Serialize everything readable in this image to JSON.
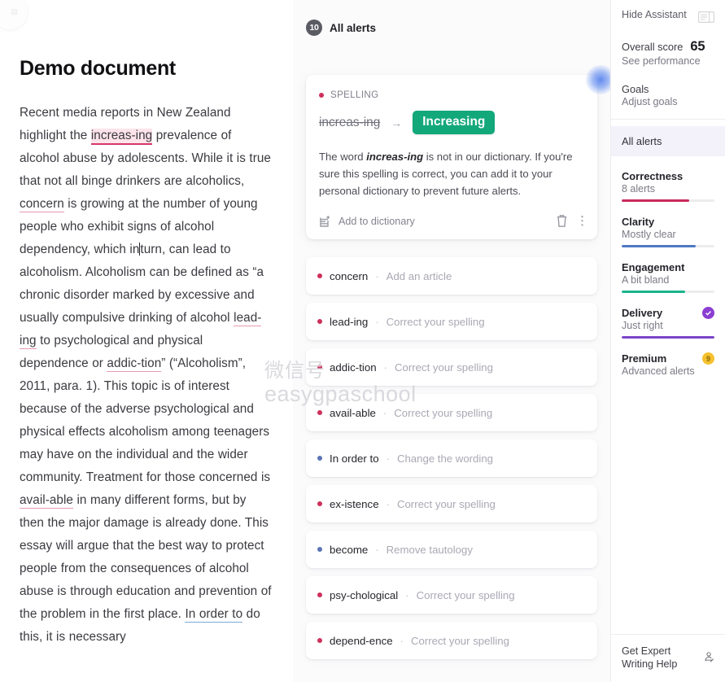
{
  "document": {
    "title": "Demo document",
    "paragraph_parts": [
      {
        "t": "Recent media reports in New Zealand highlight the ",
        "k": "plain"
      },
      {
        "t": "increas-ing",
        "k": "spelling-highlight"
      },
      {
        "t": " prevalence of alcohol abuse by adolescents. While it is true that not all binge drinkers are alcoholics, ",
        "k": "plain"
      },
      {
        "t": "concern",
        "k": "spelling-underline"
      },
      {
        "t": " is growing at the number of young people who exhibit signs of alcohol dependency, which in",
        "k": "plain"
      },
      {
        "t": "|",
        "k": "caret"
      },
      {
        "t": "turn, can lead to alcoholism. Alcoholism can be defined as “a chronic disorder marked by excessive and usually compulsive drinking of alcohol ",
        "k": "plain"
      },
      {
        "t": "lead-ing",
        "k": "spelling-underline"
      },
      {
        "t": " to psychological and physical dependence or ",
        "k": "plain"
      },
      {
        "t": "addic-tion",
        "k": "spelling-underline"
      },
      {
        "t": "” (“Alcoholism”, 2011, para. 1). This topic is of interest because of the adverse psychological and physical effects alcoholism among teenagers may have on the individual and the wider community. Treatment for those concerned is ",
        "k": "plain"
      },
      {
        "t": "avail-able",
        "k": "spelling-underline"
      },
      {
        "t": " in many different forms, but by then the major damage is already done. This essay will argue that the best way to protect people from the consequences of alcohol abuse is through education and prevention of the problem in the first place. ",
        "k": "plain"
      },
      {
        "t": "In order to",
        "k": "clarity-underline"
      },
      {
        "t": " do this, it is necessary",
        "k": "plain"
      }
    ]
  },
  "alerts_panel": {
    "header": {
      "count": "10",
      "title": "All alerts"
    },
    "expanded_card": {
      "category": "SPELLING",
      "category_dot_color": "#cf2f5b",
      "original_word": "increas-ing",
      "arrow": "→",
      "suggested_word": "Increasing",
      "suggestion_color": "#12a87a",
      "explanation_prefix": "The word ",
      "explanation_word": "increas-ing",
      "explanation_suffix": " is not in our dictionary. If you're sure this spelling is correct, you can add it to your personal dictionary to prevent future alerts.",
      "add_to_dictionary_label": "Add to dictionary",
      "add_icon": "book-plus-icon",
      "delete_icon": "trash-icon",
      "more_icon": "more-vertical-icon"
    },
    "rows": [
      {
        "word": "concern",
        "separator": "·",
        "action": "Add an article",
        "dot": "#cf2f5b"
      },
      {
        "word": "lead-ing",
        "separator": "·",
        "action": "Correct your spelling",
        "dot": "#cf2f5b"
      },
      {
        "word": "addic-tion",
        "separator": "·",
        "action": "Correct your spelling",
        "dot": "#cf2f5b"
      },
      {
        "word": "avail-able",
        "separator": "·",
        "action": "Correct your spelling",
        "dot": "#cf2f5b"
      },
      {
        "word": "In order to",
        "separator": "·",
        "action": "Change the wording",
        "dot": "#5b74b5"
      },
      {
        "word": "ex-istence",
        "separator": "·",
        "action": "Correct your spelling",
        "dot": "#cf2f5b"
      },
      {
        "word": "become",
        "separator": "·",
        "action": "Remove tautology",
        "dot": "#5b74b5"
      },
      {
        "word": "psy-chological",
        "separator": "·",
        "action": "Correct your spelling",
        "dot": "#cf2f5b"
      },
      {
        "word": "depend-ence",
        "separator": "·",
        "action": "Correct your spelling",
        "dot": "#cf2f5b"
      }
    ]
  },
  "sidebar": {
    "hide_assistant_label": "Hide Assistant",
    "panel_toggle_icon": "panel-collapse-icon",
    "overall": {
      "label": "Overall score",
      "value": "65",
      "sub": "See performance"
    },
    "goals": {
      "label": "Goals",
      "sub": "Adjust goals"
    },
    "all_alerts_label": "All alerts",
    "metrics": [
      {
        "name": "Correctness",
        "sub": "8 alerts",
        "fill": 73,
        "color": "#c92a5c",
        "badge": null
      },
      {
        "name": "Clarity",
        "sub": "Mostly clear",
        "fill": 80,
        "color": "#4f78c4",
        "badge": null
      },
      {
        "name": "Engagement",
        "sub": "A bit bland",
        "fill": 68,
        "color": "#19b48c",
        "badge": null
      },
      {
        "name": "Delivery",
        "sub": "Just right",
        "fill": 100,
        "color": "#7b45c9",
        "badge": "check"
      },
      {
        "name": "Premium",
        "sub": "Advanced alerts",
        "fill": 0,
        "color": "#f5c12e",
        "badge": "9"
      }
    ],
    "footer": {
      "label": "Get Expert Writing Help",
      "icon": "writer-person-icon"
    }
  },
  "watermark": {
    "line1": "微信号",
    "line2": "easygpaschool"
  }
}
